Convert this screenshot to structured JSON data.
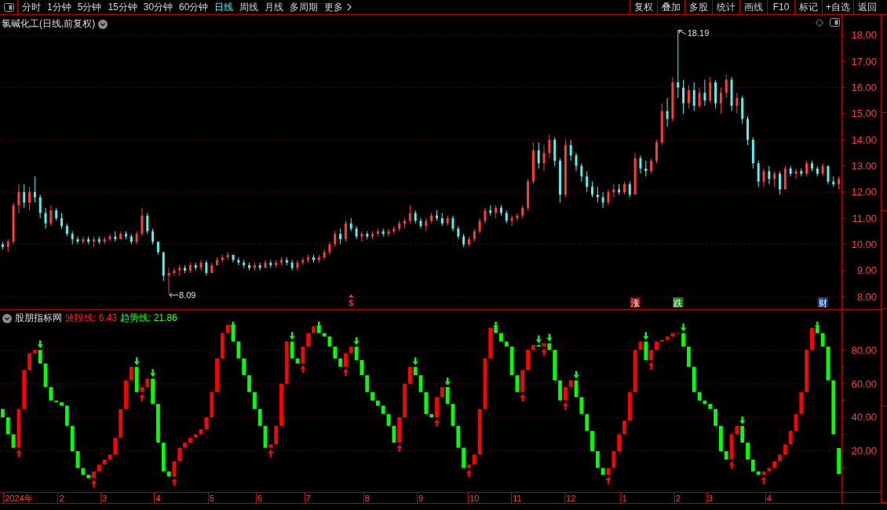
{
  "toolbar": {
    "periods": [
      {
        "label": "分时",
        "selected": false,
        "kind": "period"
      },
      {
        "label": "1分钟",
        "selected": false,
        "kind": "period"
      },
      {
        "label": "5分钟",
        "selected": false,
        "kind": "period"
      },
      {
        "label": "15分钟",
        "selected": false,
        "kind": "period"
      },
      {
        "label": "30分钟",
        "selected": false,
        "kind": "period"
      },
      {
        "label": "60分钟",
        "selected": false,
        "kind": "period"
      },
      {
        "label": "日线",
        "selected": true,
        "kind": "period"
      },
      {
        "label": "周线",
        "selected": false,
        "kind": "period"
      },
      {
        "label": "月线",
        "selected": false,
        "kind": "period"
      },
      {
        "label": "多周期",
        "selected": false,
        "kind": "period"
      },
      {
        "label": "更多",
        "selected": false,
        "kind": "more"
      }
    ],
    "actions": [
      "复权",
      "叠加",
      "多股",
      "统计",
      "画线",
      "F10",
      "标记",
      "+自选",
      "返回"
    ]
  },
  "price_pane": {
    "title": "氯碱化工(日线,前复权)",
    "events": [
      {
        "kind": "dividend"
      },
      {
        "kind": "rise"
      },
      {
        "kind": "fall"
      },
      {
        "kind": "report"
      }
    ],
    "chart_data": [
      {
        "type": "candlestick",
        "ylim": [
          7.52,
          18.78
        ],
        "yticks": [
          {
            "value": 18,
            "label": "18.00"
          },
          {
            "value": 17,
            "label": "17.00"
          },
          {
            "value": 16,
            "label": "16.00"
          },
          {
            "value": 15,
            "label": "15.00"
          },
          {
            "value": 14,
            "label": "14.00"
          },
          {
            "value": 13,
            "label": "13.00"
          },
          {
            "value": 12,
            "label": "12.00"
          },
          {
            "value": 11,
            "label": "11.00"
          },
          {
            "value": 10,
            "label": "10.00"
          },
          {
            "value": 9,
            "label": "9.00"
          },
          {
            "value": 8,
            "label": "8.00"
          }
        ],
        "grid": "alternate",
        "categories": [
          null,
          null,
          null,
          null,
          null,
          null,
          null,
          null,
          null,
          null,
          null,
          null,
          null,
          null,
          null,
          null,
          null,
          null,
          null,
          null,
          null,
          null,
          null,
          null,
          null,
          null,
          null,
          null,
          null,
          null,
          null,
          null,
          null,
          null,
          null,
          null,
          null,
          null,
          null,
          null,
          null,
          null,
          null,
          null,
          null,
          null,
          null,
          null,
          null,
          null,
          null,
          null,
          null,
          null,
          null,
          null,
          null,
          null,
          null,
          null,
          null,
          null,
          null,
          null,
          null,
          "$",
          null,
          null,
          null,
          null,
          null,
          null,
          null,
          null,
          null,
          null,
          null,
          null,
          null,
          null,
          null,
          null,
          null,
          null,
          null,
          null,
          null,
          null,
          null,
          null,
          null,
          null,
          null,
          null,
          null,
          null,
          null,
          null,
          null,
          null,
          null,
          null,
          null,
          null,
          null,
          null,
          null,
          null,
          null,
          null,
          null,
          null,
          null,
          null,
          null,
          null,
          null,
          null,
          "涨",
          null,
          null,
          null,
          null,
          null,
          null,
          null,
          "跌",
          null,
          null,
          null,
          null,
          null,
          null,
          null,
          null,
          null,
          null,
          null,
          null,
          null,
          null,
          null,
          null,
          null,
          null,
          null,
          null,
          null,
          null,
          null,
          null,
          null,
          null,
          "财",
          null,
          null,
          null
        ],
        "ohlc": [
          [
            10.0,
            10.1,
            9.8,
            9.9
          ],
          [
            9.9,
            10.2,
            9.7,
            10.1
          ],
          [
            10.1,
            11.6,
            10.0,
            11.5
          ],
          [
            11.5,
            12.3,
            11.2,
            12.0
          ],
          [
            12.0,
            12.3,
            11.4,
            11.6
          ],
          [
            11.6,
            12.2,
            11.3,
            12.0
          ],
          [
            12.0,
            12.6,
            11.6,
            11.8
          ],
          [
            11.8,
            11.9,
            11.0,
            11.2
          ],
          [
            11.2,
            11.4,
            10.6,
            10.8
          ],
          [
            10.8,
            11.5,
            10.7,
            11.3
          ],
          [
            11.3,
            11.4,
            10.9,
            11.0
          ],
          [
            11.0,
            11.2,
            10.6,
            10.7
          ],
          [
            10.7,
            10.8,
            10.3,
            10.4
          ],
          [
            10.4,
            10.5,
            10.0,
            10.2
          ],
          [
            10.2,
            10.3,
            10.0,
            10.1
          ],
          [
            10.1,
            10.3,
            10.0,
            10.2
          ],
          [
            10.2,
            10.3,
            10.0,
            10.1
          ],
          [
            10.1,
            10.3,
            9.9,
            10.2
          ],
          [
            10.2,
            10.3,
            10.0,
            10.1
          ],
          [
            10.1,
            10.3,
            10.0,
            10.2
          ],
          [
            10.2,
            10.4,
            10.1,
            10.3
          ],
          [
            10.3,
            10.5,
            10.1,
            10.2
          ],
          [
            10.2,
            10.5,
            10.2,
            10.4
          ],
          [
            10.4,
            10.5,
            10.2,
            10.3
          ],
          [
            10.3,
            10.4,
            10.0,
            10.1
          ],
          [
            10.1,
            10.5,
            10.0,
            10.4
          ],
          [
            10.4,
            11.4,
            10.3,
            11.1
          ],
          [
            11.1,
            11.2,
            10.4,
            10.5
          ],
          [
            10.5,
            10.6,
            10.0,
            10.1
          ],
          [
            10.1,
            10.1,
            9.6,
            9.7
          ],
          [
            9.7,
            9.7,
            8.6,
            8.8
          ],
          [
            8.8,
            9.1,
            8.09,
            8.9
          ],
          [
            8.9,
            9.1,
            8.8,
            9.0
          ],
          [
            9.0,
            9.2,
            8.8,
            9.1
          ],
          [
            9.1,
            9.2,
            8.9,
            9.0
          ],
          [
            9.0,
            9.3,
            8.9,
            9.2
          ],
          [
            9.2,
            9.3,
            9.0,
            9.1
          ],
          [
            9.1,
            9.4,
            9.0,
            9.3
          ],
          [
            9.3,
            9.4,
            8.8,
            8.9
          ],
          [
            8.9,
            9.3,
            8.9,
            9.2
          ],
          [
            9.2,
            9.5,
            9.2,
            9.4
          ],
          [
            9.4,
            9.6,
            9.3,
            9.5
          ],
          [
            9.5,
            9.7,
            9.4,
            9.6
          ],
          [
            9.6,
            9.6,
            9.3,
            9.4
          ],
          [
            9.4,
            9.5,
            9.2,
            9.3
          ],
          [
            9.3,
            9.4,
            9.1,
            9.2
          ],
          [
            9.2,
            9.3,
            9.0,
            9.1
          ],
          [
            9.1,
            9.3,
            9.0,
            9.2
          ],
          [
            9.2,
            9.3,
            9.0,
            9.1
          ],
          [
            9.1,
            9.4,
            9.1,
            9.3
          ],
          [
            9.3,
            9.4,
            9.1,
            9.2
          ],
          [
            9.2,
            9.4,
            9.1,
            9.3
          ],
          [
            9.3,
            9.5,
            9.2,
            9.4
          ],
          [
            9.4,
            9.5,
            9.2,
            9.3
          ],
          [
            9.3,
            9.4,
            9.0,
            9.1
          ],
          [
            9.1,
            9.4,
            9.0,
            9.3
          ],
          [
            9.3,
            9.5,
            9.2,
            9.4
          ],
          [
            9.4,
            9.6,
            9.3,
            9.5
          ],
          [
            9.5,
            9.6,
            9.3,
            9.4
          ],
          [
            9.4,
            9.6,
            9.3,
            9.5
          ],
          [
            9.5,
            9.8,
            9.4,
            9.7
          ],
          [
            9.7,
            10.1,
            9.6,
            10.0
          ],
          [
            10.0,
            10.5,
            9.9,
            10.4
          ],
          [
            10.4,
            10.6,
            10.0,
            10.2
          ],
          [
            10.2,
            10.9,
            10.1,
            10.8
          ],
          [
            10.8,
            11.0,
            10.5,
            10.6
          ],
          [
            10.6,
            10.7,
            10.2,
            10.3
          ],
          [
            10.3,
            10.5,
            10.1,
            10.4
          ],
          [
            10.4,
            10.5,
            10.2,
            10.3
          ],
          [
            10.3,
            10.5,
            10.2,
            10.4
          ],
          [
            10.4,
            10.6,
            10.3,
            10.5
          ],
          [
            10.5,
            10.6,
            10.3,
            10.4
          ],
          [
            10.4,
            10.6,
            10.3,
            10.5
          ],
          [
            10.5,
            10.7,
            10.4,
            10.6
          ],
          [
            10.6,
            10.9,
            10.5,
            10.8
          ],
          [
            10.8,
            11.0,
            10.6,
            10.9
          ],
          [
            10.9,
            11.5,
            10.8,
            11.2
          ],
          [
            11.2,
            11.3,
            10.8,
            10.9
          ],
          [
            10.9,
            11.0,
            10.6,
            10.7
          ],
          [
            10.7,
            11.0,
            10.5,
            10.9
          ],
          [
            10.9,
            11.2,
            10.8,
            11.1
          ],
          [
            11.1,
            11.3,
            10.9,
            11.0
          ],
          [
            11.0,
            11.2,
            10.7,
            10.8
          ],
          [
            10.8,
            11.1,
            10.7,
            11.0
          ],
          [
            11.0,
            11.1,
            10.5,
            10.6
          ],
          [
            10.6,
            10.7,
            10.2,
            10.3
          ],
          [
            10.3,
            10.4,
            9.9,
            10.0
          ],
          [
            10.0,
            10.3,
            9.9,
            10.2
          ],
          [
            10.2,
            10.6,
            10.1,
            10.5
          ],
          [
            10.5,
            11.0,
            10.4,
            10.9
          ],
          [
            10.9,
            11.4,
            10.8,
            11.3
          ],
          [
            11.3,
            11.5,
            11.1,
            11.2
          ],
          [
            11.2,
            11.5,
            11.0,
            11.4
          ],
          [
            11.4,
            11.5,
            11.1,
            11.2
          ],
          [
            11.2,
            11.3,
            10.8,
            10.9
          ],
          [
            10.9,
            11.1,
            10.7,
            11.0
          ],
          [
            11.0,
            11.2,
            10.9,
            11.1
          ],
          [
            11.1,
            11.5,
            11.0,
            11.4
          ],
          [
            11.4,
            12.5,
            11.3,
            12.4
          ],
          [
            12.4,
            13.9,
            12.3,
            13.6
          ],
          [
            13.6,
            13.9,
            12.9,
            13.1
          ],
          [
            13.1,
            13.8,
            12.8,
            13.5
          ],
          [
            13.5,
            14.2,
            13.3,
            14.0
          ],
          [
            14.0,
            14.1,
            13.0,
            13.2
          ],
          [
            13.2,
            13.3,
            11.6,
            11.9
          ],
          [
            11.9,
            14.0,
            11.8,
            13.8
          ],
          [
            13.8,
            14.0,
            13.2,
            13.4
          ],
          [
            13.4,
            13.5,
            12.8,
            13.0
          ],
          [
            13.0,
            13.1,
            12.4,
            12.6
          ],
          [
            12.6,
            12.8,
            12.0,
            12.2
          ],
          [
            12.2,
            12.4,
            11.8,
            11.9
          ],
          [
            11.9,
            12.2,
            11.6,
            11.8
          ],
          [
            11.8,
            12.0,
            11.4,
            11.6
          ],
          [
            11.6,
            12.1,
            11.5,
            12.0
          ],
          [
            12.0,
            12.3,
            11.8,
            12.1
          ],
          [
            12.1,
            12.3,
            11.9,
            12.0
          ],
          [
            12.0,
            12.4,
            11.9,
            12.3
          ],
          [
            12.3,
            12.4,
            11.8,
            11.9
          ],
          [
            11.9,
            13.5,
            11.9,
            13.3
          ],
          [
            13.3,
            13.4,
            12.7,
            12.9
          ],
          [
            12.9,
            13.2,
            12.6,
            12.8
          ],
          [
            12.8,
            13.3,
            12.7,
            13.2
          ],
          [
            13.2,
            14.0,
            13.1,
            13.9
          ],
          [
            13.9,
            15.4,
            13.8,
            15.1
          ],
          [
            15.1,
            15.6,
            14.5,
            14.8
          ],
          [
            14.8,
            16.4,
            14.7,
            16.2
          ],
          [
            16.2,
            18.19,
            15.6,
            16.0
          ],
          [
            16.0,
            16.3,
            15.0,
            15.4
          ],
          [
            15.4,
            16.1,
            15.2,
            15.9
          ],
          [
            15.9,
            16.2,
            15.1,
            15.3
          ],
          [
            15.3,
            16.0,
            15.2,
            15.8
          ],
          [
            15.8,
            16.3,
            15.3,
            15.5
          ],
          [
            15.5,
            16.4,
            15.4,
            16.2
          ],
          [
            16.2,
            16.3,
            15.2,
            15.4
          ],
          [
            15.4,
            16.0,
            15.0,
            15.8
          ],
          [
            15.8,
            16.5,
            15.6,
            16.3
          ],
          [
            16.3,
            16.4,
            15.1,
            15.3
          ],
          [
            15.3,
            15.8,
            15.0,
            15.6
          ],
          [
            15.6,
            15.7,
            14.6,
            14.8
          ],
          [
            14.8,
            14.9,
            13.8,
            14.0
          ],
          [
            14.0,
            14.1,
            12.9,
            13.1
          ],
          [
            13.1,
            13.2,
            12.2,
            12.4
          ],
          [
            12.4,
            12.9,
            12.2,
            12.8
          ],
          [
            12.8,
            13.0,
            12.3,
            12.5
          ],
          [
            12.5,
            12.8,
            12.2,
            12.7
          ],
          [
            12.7,
            12.8,
            11.9,
            12.1
          ],
          [
            12.1,
            13.0,
            12.1,
            12.9
          ],
          [
            12.9,
            13.0,
            12.6,
            12.7
          ],
          [
            12.7,
            12.9,
            12.5,
            12.8
          ],
          [
            12.8,
            12.9,
            12.6,
            12.7
          ],
          [
            12.7,
            13.2,
            12.6,
            13.1
          ],
          [
            13.1,
            13.2,
            12.8,
            12.9
          ],
          [
            12.9,
            13.0,
            12.6,
            12.7
          ],
          [
            12.7,
            13.1,
            12.6,
            13.0
          ],
          [
            13.0,
            13.0,
            12.3,
            12.4
          ],
          [
            12.4,
            12.6,
            12.2,
            12.3
          ],
          [
            12.3,
            12.6,
            12.1,
            12.5
          ]
        ],
        "annotations": [
          "18.19",
          "8.09"
        ]
      }
    ]
  },
  "indicator_pane": {
    "name": "股朋指标网",
    "readings": [
      {
        "text": "波段线: 6.43",
        "color": "#ff2020"
      },
      {
        "text": "趋势线: 21.86",
        "color": "#20ff20"
      }
    ],
    "chart_data": [
      {
        "type": "bar",
        "ylim": [
          -4.2,
          104.2
        ],
        "yticks": [
          {
            "value": 80,
            "label": "80.00"
          },
          {
            "value": 60,
            "label": "60.00"
          },
          {
            "value": 40,
            "label": "40.00"
          },
          {
            "value": 20,
            "label": "20.00"
          }
        ],
        "grid": true,
        "categories": [
          null,
          null,
          null,
          "2024年",
          null,
          null,
          null,
          null,
          null,
          null,
          null,
          "2",
          null,
          null,
          null,
          null,
          null,
          null,
          null,
          "3",
          null,
          null,
          null,
          null,
          null,
          null,
          null,
          null,
          null,
          "4",
          null,
          null,
          null,
          null,
          null,
          null,
          null,
          null,
          null,
          "5",
          null,
          null,
          null,
          null,
          null,
          null,
          null,
          null,
          "6",
          null,
          null,
          null,
          null,
          null,
          null,
          null,
          null,
          "7",
          null,
          null,
          null,
          null,
          null,
          null,
          null,
          null,
          null,
          null,
          "8",
          null,
          null,
          null,
          null,
          null,
          null,
          null,
          null,
          null,
          "9",
          null,
          null,
          null,
          null,
          null,
          null,
          null,
          null,
          null,
          "10",
          null,
          null,
          null,
          null,
          null,
          null,
          null,
          "11",
          null,
          null,
          null,
          null,
          null,
          null,
          null,
          null,
          null,
          "12",
          null,
          null,
          null,
          null,
          null,
          null,
          null,
          null,
          null,
          "1",
          null,
          null,
          null,
          null,
          null,
          null,
          null,
          null,
          null,
          "2",
          null,
          null,
          null,
          null,
          null,
          "3",
          null,
          null,
          null,
          null,
          null,
          null,
          null,
          null,
          null,
          null,
          "4",
          null,
          null,
          null,
          null,
          null,
          null,
          null,
          null,
          null,
          null,
          null,
          null,
          null
        ],
        "base": [
          45,
          40,
          30,
          22,
          45,
          68,
          78,
          80,
          72,
          58,
          50,
          49,
          47,
          35,
          20,
          10,
          6,
          4,
          8,
          12,
          15,
          18,
          28,
          45,
          62,
          70,
          55,
          58,
          63,
          48,
          25,
          8,
          5,
          14,
          22,
          25,
          28,
          30,
          33,
          40,
          55,
          75,
          90,
          95,
          85,
          75,
          65,
          55,
          45,
          35,
          22,
          24,
          35,
          60,
          85,
          75,
          72,
          82,
          90,
          94,
          90,
          88,
          82,
          75,
          70,
          78,
          82,
          74,
          65,
          55,
          50,
          47,
          42,
          35,
          25,
          40,
          60,
          70,
          65,
          55,
          42,
          40,
          52,
          58,
          48,
          35,
          22,
          10,
          12,
          18,
          45,
          75,
          93,
          90,
          85,
          82,
          65,
          55,
          68,
          80,
          83,
          82,
          84,
          80,
          62,
          50,
          58,
          62,
          52,
          42,
          32,
          20,
          10,
          6,
          10,
          20,
          30,
          38,
          55,
          80,
          85,
          74,
          80,
          85,
          86,
          88,
          90,
          90,
          82,
          70,
          55,
          50,
          48,
          45,
          35,
          20,
          15,
          30,
          35,
          25,
          15,
          8,
          6,
          8,
          10,
          14,
          18,
          24,
          32,
          42,
          55,
          80,
          93,
          90,
          82,
          62,
          21.86
        ],
        "values": [
          -5,
          -10,
          -8,
          23,
          23,
          10,
          2,
          -8,
          -14,
          -8,
          -1,
          -2,
          -12,
          -15,
          -10,
          -4,
          -2,
          4,
          4,
          3,
          3,
          10,
          17,
          17,
          8,
          -15,
          3,
          5,
          -15,
          -23,
          -17,
          -3,
          9,
          8,
          3,
          3,
          2,
          3,
          7,
          15,
          20,
          15,
          5,
          -10,
          -10,
          -10,
          -10,
          -10,
          -10,
          -13,
          2,
          11,
          25,
          25,
          -10,
          -3,
          10,
          8,
          4,
          -4,
          -2,
          -6,
          -7,
          -5,
          8,
          4,
          -8,
          -9,
          -10,
          -5,
          -3,
          -5,
          -7,
          -10,
          15,
          20,
          10,
          -5,
          -10,
          -13,
          -2,
          12,
          6,
          -10,
          -13,
          -13,
          -12,
          2,
          6,
          27,
          30,
          18,
          -3,
          -5,
          -3,
          -17,
          -10,
          13,
          12,
          3,
          -1,
          2,
          -4,
          -18,
          -12,
          8,
          4,
          -10,
          -10,
          -10,
          -12,
          -10,
          -4,
          4,
          10,
          10,
          8,
          17,
          25,
          5,
          -11,
          6,
          5,
          1,
          2,
          2,
          0,
          -8,
          -12,
          -15,
          -5,
          -2,
          -3,
          -10,
          -15,
          -5,
          15,
          5,
          -10,
          -10,
          -7,
          -2,
          2,
          2,
          4,
          4,
          6,
          8,
          10,
          13,
          25,
          13,
          -3,
          -8,
          -20,
          -32,
          -15.43
        ],
        "colors": [
          "#00ff00",
          "#00ff00",
          "#00ff00",
          "#ff0000",
          "#ff0000",
          "#ff0000",
          "#ff0000",
          "#00ff00",
          "#00ff00",
          "#00ff00",
          "#00ff00",
          "#00ff00",
          "#00ff00",
          "#00ff00",
          "#00ff00",
          "#00ff00",
          "#00ff00",
          "#ff0000",
          "#ff0000",
          "#ff0000",
          "#ff0000",
          "#ff0000",
          "#ff0000",
          "#ff0000",
          "#ff0000",
          "#00ff00",
          "#ff0000",
          "#ff0000",
          "#00ff00",
          "#00ff00",
          "#00ff00",
          "#00ff00",
          "#ff0000",
          "#ff0000",
          "#ff0000",
          "#ff0000",
          "#ff0000",
          "#ff0000",
          "#ff0000",
          "#ff0000",
          "#ff0000",
          "#ff0000",
          "#ff0000",
          "#00ff00",
          "#00ff00",
          "#00ff00",
          "#00ff00",
          "#00ff00",
          "#00ff00",
          "#00ff00",
          "#ff0000",
          "#ff0000",
          "#ff0000",
          "#ff0000",
          "#00ff00",
          "#00ff00",
          "#ff0000",
          "#ff0000",
          "#ff0000",
          "#00ff00",
          "#00ff00",
          "#00ff00",
          "#00ff00",
          "#00ff00",
          "#ff0000",
          "#ff0000",
          "#00ff00",
          "#00ff00",
          "#00ff00",
          "#00ff00",
          "#00ff00",
          "#00ff00",
          "#00ff00",
          "#00ff00",
          "#ff0000",
          "#ff0000",
          "#ff0000",
          "#00ff00",
          "#00ff00",
          "#00ff00",
          "#00ff00",
          "#ff0000",
          "#ff0000",
          "#00ff00",
          "#00ff00",
          "#00ff00",
          "#00ff00",
          "#ff0000",
          "#ff0000",
          "#ff0000",
          "#ff0000",
          "#ff0000",
          "#00ff00",
          "#00ff00",
          "#00ff00",
          "#00ff00",
          "#00ff00",
          "#ff0000",
          "#ff0000",
          "#ff0000",
          "#00ff00",
          "#ff0000",
          "#00ff00",
          "#00ff00",
          "#00ff00",
          "#ff0000",
          "#ff0000",
          "#00ff00",
          "#00ff00",
          "#00ff00",
          "#00ff00",
          "#00ff00",
          "#00ff00",
          "#ff0000",
          "#ff0000",
          "#ff0000",
          "#ff0000",
          "#ff0000",
          "#ff0000",
          "#ff0000",
          "#00ff00",
          "#ff0000",
          "#ff0000",
          "#ff0000",
          "#ff0000",
          "#ff0000",
          "#ff0000",
          "#00ff00",
          "#00ff00",
          "#00ff00",
          "#00ff00",
          "#00ff00",
          "#00ff00",
          "#00ff00",
          "#00ff00",
          "#00ff00",
          "#ff0000",
          "#ff0000",
          "#00ff00",
          "#00ff00",
          "#00ff00",
          "#00ff00",
          "#ff0000",
          "#ff0000",
          "#ff0000",
          "#ff0000",
          "#ff0000",
          "#ff0000",
          "#ff0000",
          "#ff0000",
          "#ff0000",
          "#ff0000",
          "#00ff00",
          "#00ff00",
          "#00ff00",
          "#00ff00",
          "#00ff00"
        ]
      }
    ]
  }
}
